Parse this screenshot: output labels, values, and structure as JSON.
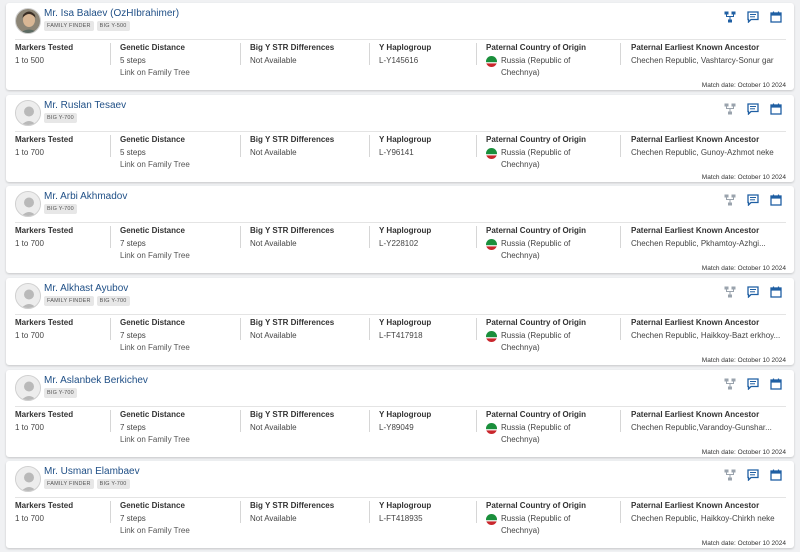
{
  "labels": {
    "markers": "Markers Tested",
    "distance": "Genetic Distance",
    "str": "Big Y STR Differences",
    "haplo": "Y Haplogroup",
    "country": "Paternal Country of Origin",
    "ancestor": "Paternal Earliest Known Ancestor",
    "family_tree_link": "Link on Family Tree"
  },
  "colors": {
    "accent": "#1f5fa3",
    "name": "#1f4f86",
    "flag_green": "#1a8f3c",
    "flag_red": "#c9262c"
  },
  "matches": [
    {
      "name": "Mr. Isa Balaev (OzHIbrahimer)",
      "avatar": "photo",
      "badges": [
        "FAMILY FINDER",
        "BIG Y-500"
      ],
      "icons": [
        "tree-icon",
        "chat-icon",
        "calendar-icon"
      ],
      "tree_icon_active": true,
      "markers": "1 to 500",
      "distance": "5 steps",
      "show_link": true,
      "str": "Not Available",
      "haplogroup": "L-Y145616",
      "country": "Russia (Republic of Chechnya)",
      "ancestor": "Chechen Republic, Vashtarcy-Sonur gar",
      "date": "Match date: October 10 2024"
    },
    {
      "name": "Mr. Ruslan Tesaev",
      "avatar": "placeholder",
      "badges": [
        "BIG Y-700"
      ],
      "icons": [
        "tree-icon",
        "chat-icon",
        "calendar-icon"
      ],
      "tree_icon_active": false,
      "markers": "1 to 700",
      "distance": "5 steps",
      "show_link": true,
      "str": "Not Available",
      "haplogroup": "L-Y96141",
      "country": "Russia (Republic of Chechnya)",
      "ancestor": "Chechen Republic, Gunoy-Azhmot neke",
      "date": "Match date: October 10 2024"
    },
    {
      "name": "Mr. Arbi Akhmadov",
      "avatar": "placeholder",
      "badges": [
        "BIG Y-700"
      ],
      "icons": [
        "tree-icon",
        "chat-icon",
        "calendar-icon"
      ],
      "tree_icon_active": false,
      "markers": "1 to 700",
      "distance": "7 steps",
      "show_link": true,
      "str": "Not Available",
      "haplogroup": "L-Y228102",
      "country": "Russia (Republic of Chechnya)",
      "ancestor": "Chechen Republic, Pkhamtoy-Azhgi...",
      "date": "Match date: October 10 2024"
    },
    {
      "name": "Mr. Alkhast Ayubov",
      "avatar": "placeholder",
      "badges": [
        "FAMILY FINDER",
        "BIG Y-700"
      ],
      "icons": [
        "tree-icon",
        "chat-icon",
        "calendar-icon"
      ],
      "tree_icon_active": false,
      "markers": "1 to 700",
      "distance": "7 steps",
      "show_link": true,
      "str": "Not Available",
      "haplogroup": "L-FT417918",
      "country": "Russia (Republic of Chechnya)",
      "ancestor": "Chechen Republic, Haikkoy-Bazt erkhoy...",
      "date": "Match date: October 10 2024"
    },
    {
      "name": "Mr. Aslanbek Berkichev",
      "avatar": "placeholder",
      "badges": [
        "BIG Y-700"
      ],
      "icons": [
        "tree-icon",
        "chat-icon",
        "calendar-icon"
      ],
      "tree_icon_active": false,
      "markers": "1 to 700",
      "distance": "7 steps",
      "show_link": true,
      "str": "Not Available",
      "haplogroup": "L-Y89049",
      "country": "Russia (Republic of Chechnya)",
      "ancestor": "Chechen Republic,Varandoy-Gunshar...",
      "date": "Match date: October 10 2024"
    },
    {
      "name": "Mr. Usman Elambaev",
      "avatar": "placeholder",
      "badges": [
        "FAMILY FINDER",
        "BIG Y-700"
      ],
      "icons": [
        "tree-icon",
        "chat-icon",
        "calendar-icon"
      ],
      "tree_icon_active": false,
      "markers": "1 to 700",
      "distance": "7 steps",
      "show_link": true,
      "str": "Not Available",
      "haplogroup": "L-FT418935",
      "country": "Russia (Republic of Chechnya)",
      "ancestor": "Chechen Republic, Haikkoy-Chirkh neke",
      "date": "Match date: October 10 2024"
    }
  ]
}
